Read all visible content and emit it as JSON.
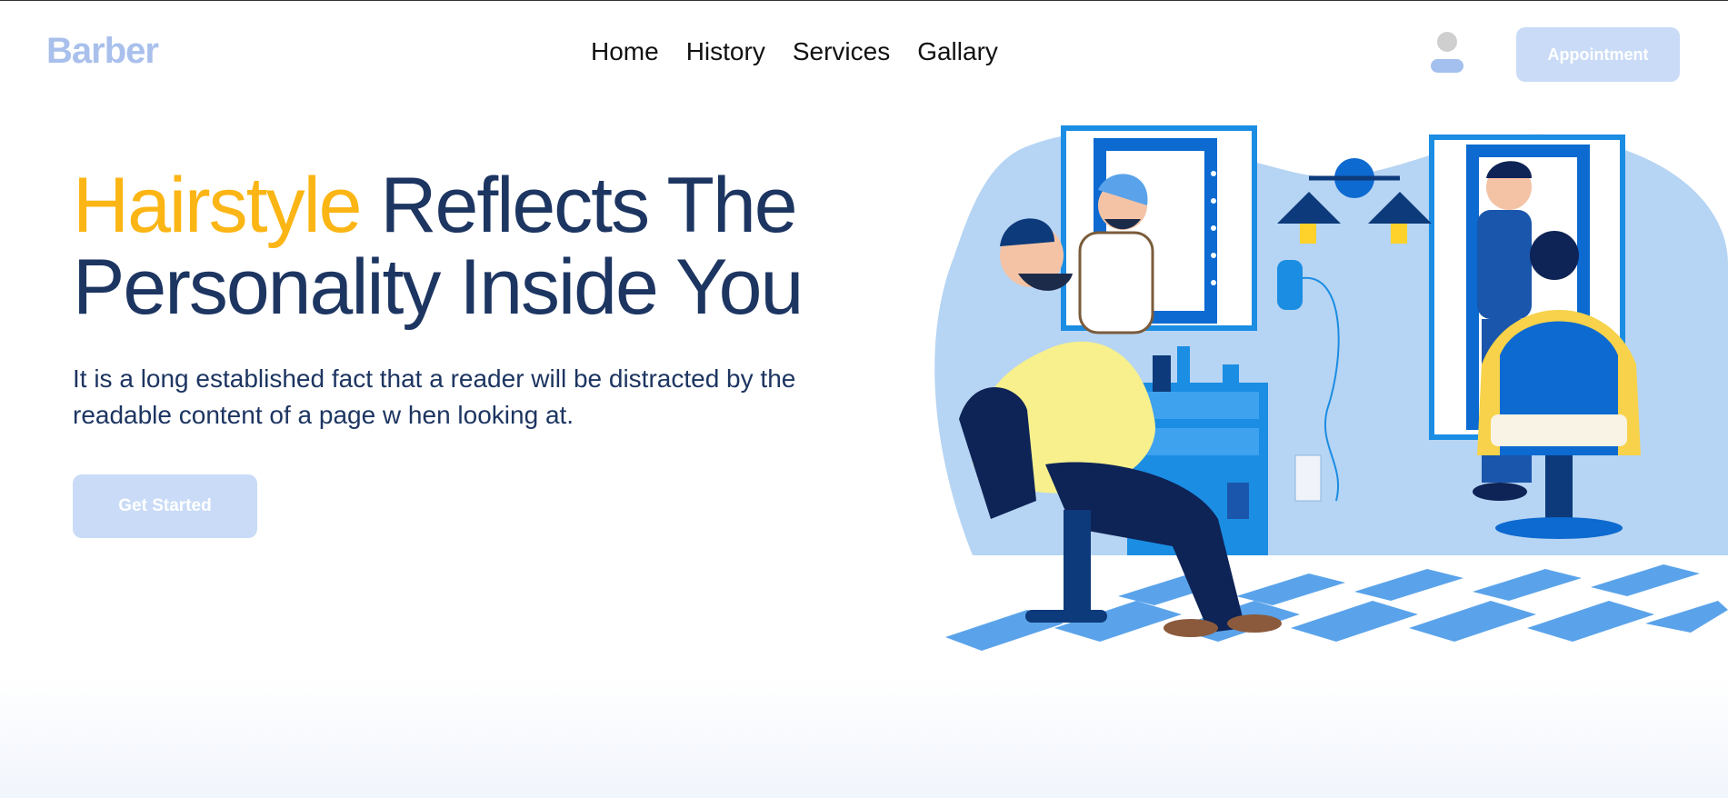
{
  "header": {
    "brand": "Barber",
    "nav": [
      "Home",
      "History",
      "Services",
      "Gallary"
    ],
    "appointment_label": "Appointment"
  },
  "hero": {
    "title_accent": "Hairstyle",
    "title_rest_line1": " Reflects The",
    "title_line2": "Personality Inside You",
    "description": "It is a long established fact that a reader will be distracted by the readable content of a page w hen looking at.",
    "cta_label": "Get Started"
  },
  "colors": {
    "accent": "#fbb514",
    "heading": "#1d3561",
    "brand": "#a9c0ec",
    "button_bg": "#c9dbf6",
    "illustration_blue": "#0a6ecf",
    "illustration_yellow": "#f7f08d"
  },
  "icons": {
    "user": "user-avatar-icon"
  }
}
